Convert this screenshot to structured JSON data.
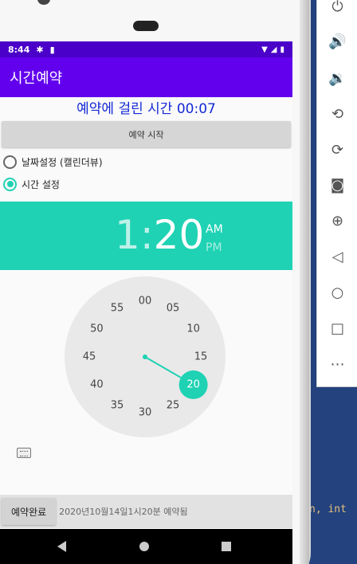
{
  "status_bar": {
    "time": "8:44",
    "icons": [
      "settings-icon",
      "sd-card-icon"
    ],
    "right_icons": [
      "wifi-icon",
      "signal-icon",
      "battery-icon"
    ]
  },
  "app_bar": {
    "title": "시간예약"
  },
  "elapsed": "예약에 걸린 시간 00:07",
  "start_button": "예약 시작",
  "radios": [
    {
      "label": "날짜설정 (캘린더뷰)",
      "checked": false
    },
    {
      "label": "시간 설정",
      "checked": true
    }
  ],
  "time_picker": {
    "hour": "1",
    "separator": ":",
    "minute": "20",
    "am": "AM",
    "pm": "PM",
    "selected_period": "AM",
    "accent_color": "#1fd2b4",
    "dial_numbers": [
      "00",
      "05",
      "10",
      "15",
      "20",
      "25",
      "30",
      "35",
      "40",
      "45",
      "50",
      "55"
    ],
    "selected_minute": "20"
  },
  "bottom": {
    "done_button": "예약완료",
    "result_text": "2020년10월14일1시20분 예약됨"
  },
  "editor_snippet": "n, int",
  "colors": {
    "status_bar": "#4a00c8",
    "app_bar": "#6200ee",
    "accent": "#1fd2b4",
    "elapsed_text": "#1428d6"
  }
}
